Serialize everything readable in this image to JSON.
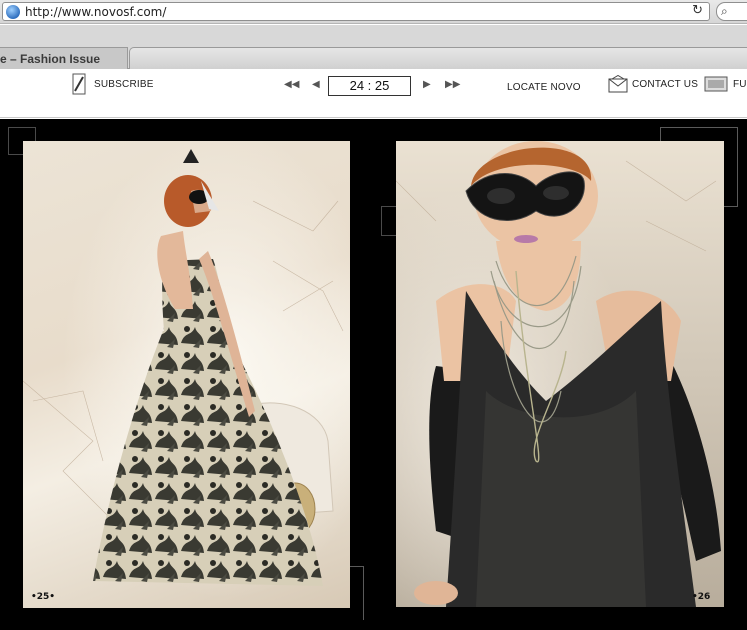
{
  "browser": {
    "url": "http://www.novosf.com/",
    "tab_title": "e – Fashion Issue"
  },
  "toolbar": {
    "subscribe_label": "SUBSCRIBE",
    "first_page_glyph": "◀◀",
    "prev_page_glyph": "◀",
    "page_indicator": "24 : 25",
    "next_page_glyph": "▶",
    "last_page_glyph": "▶▶",
    "locate_label": "LOCATE NOVO",
    "contact_label": "CONTACT US",
    "full_label": "FUL"
  },
  "magazine": {
    "left_page_number": "•25•",
    "right_page_number": "•26"
  },
  "icons": {
    "globe": "globe-icon",
    "reload": "reload-icon",
    "search": "search-icon",
    "subscribe": "pencil-icon",
    "contact": "envelope-icon",
    "fullscreen": "screen-icon"
  },
  "colors": {
    "stage_background": "#000000",
    "chrome": "#d8d8d8"
  }
}
